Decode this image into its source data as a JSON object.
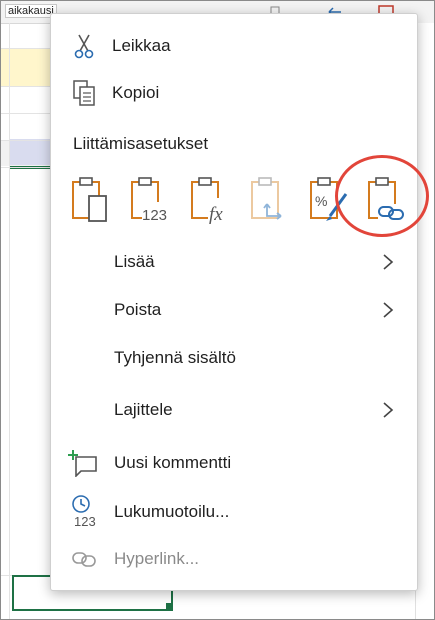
{
  "sheet": {
    "cell_tag": "aikakausi"
  },
  "menu": {
    "cut_label": "Leikkaa",
    "copy_label": "Kopioi",
    "paste_options_title": "Liittämisasetukset",
    "paste_options": [
      {
        "icon": "paste-icon"
      },
      {
        "icon": "paste-values-icon",
        "badge": "123"
      },
      {
        "icon": "paste-formulas-icon",
        "badge": "fx"
      },
      {
        "icon": "paste-transpose-icon"
      },
      {
        "icon": "paste-formatting-icon"
      },
      {
        "icon": "paste-link-icon"
      }
    ],
    "insert_label": "Lisää",
    "delete_label": "Poista",
    "clear_contents_label": "Tyhjennä sisältö",
    "sort_label": "Lajittele",
    "new_comment_label": "Uusi kommentti",
    "number_format_label": "Lukumuotoilu...",
    "number_format_badge": "123",
    "hyperlink_label": "Hyperlink..."
  },
  "colors": {
    "accent_orange": "#d47b1e",
    "icon_gray": "#555555",
    "highlight_red": "#e2453a",
    "excel_green": "#1e7145",
    "comment_green": "#2e9d50",
    "clock_blue": "#2b6cb0"
  }
}
